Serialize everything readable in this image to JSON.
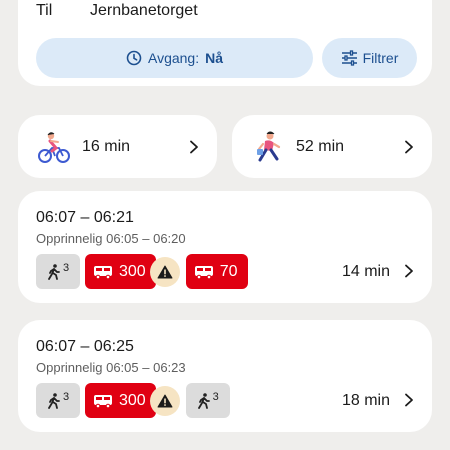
{
  "header": {
    "to_label": "Til",
    "to_value": "Jernbanetorget"
  },
  "departure": {
    "label": "Avgang:",
    "value": "Nå"
  },
  "filter": {
    "label": "Filtrer"
  },
  "modes": [
    {
      "name": "bike",
      "duration": "16 min",
      "icon": "cyclist-illustration"
    },
    {
      "name": "walk",
      "duration": "52 min",
      "icon": "walker-illustration"
    }
  ],
  "trips": [
    {
      "time": "06:07 – 06:21",
      "original": "Opprinnelig 06:05 – 06:20",
      "duration": "14 min",
      "legs": [
        {
          "type": "walk",
          "value": "3"
        },
        {
          "type": "bus",
          "value": "300",
          "warning": true
        },
        {
          "type": "bus",
          "value": "70"
        }
      ]
    },
    {
      "time": "06:07 – 06:25",
      "original": "Opprinnelig 06:05 – 06:23",
      "duration": "18 min",
      "legs": [
        {
          "type": "walk",
          "value": "3"
        },
        {
          "type": "bus",
          "value": "300",
          "warning": true
        },
        {
          "type": "walk",
          "value": "3"
        }
      ]
    }
  ],
  "colors": {
    "background": "#efeeec",
    "accent_blue": "#1c4f8f",
    "button_bg": "#dceaf8",
    "bus_red": "#e00012",
    "warning_bg": "#f6e4c3"
  }
}
